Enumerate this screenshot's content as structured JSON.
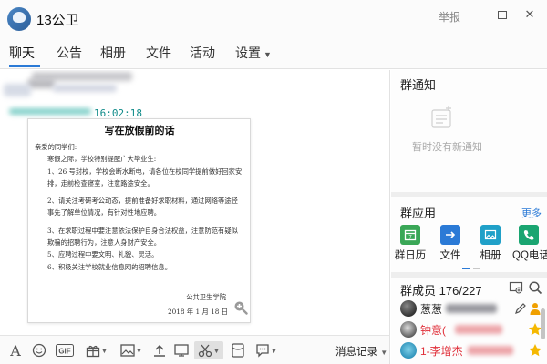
{
  "window": {
    "title": "13公卫",
    "report_label": "举报"
  },
  "tabs": [
    {
      "label": "聊天",
      "active": true
    },
    {
      "label": "公告"
    },
    {
      "label": "相册"
    },
    {
      "label": "文件"
    },
    {
      "label": "活动"
    },
    {
      "label": "设置"
    }
  ],
  "chat": {
    "message_time": "16:02:18",
    "document": {
      "title": "写在放假前的话",
      "greeting": "亲爱的同学们:",
      "intro": "寒假之际，学校特别提醒广大毕业生:",
      "items": [
        "1、26 号封校，学校会断水断电，请各位在校同学提前做好回家安排，走前检查寝室，注意路途安全。",
        "2、请关注考研考公动态，提前准备好求职材料，通过网络等途径事先了解单位情况，有针对性地应聘。",
        "3、在求职过程中要注意依法保护自身合法权益，注意防范有疑似欺骗的招聘行为，注意人身财产安全。",
        "5、应聘过程中要文明、礼貌、灵活。",
        "6、积极关注学校就业信息网的招聘信息。"
      ],
      "signature": "公共卫生学院",
      "date": "2018 年 1 月 18 日"
    }
  },
  "toolbar": {
    "history_label": "消息记录"
  },
  "notice": {
    "header": "群通知",
    "empty_text": "暂时没有新通知"
  },
  "apps": {
    "header": "群应用",
    "more_label": "更多",
    "items": [
      {
        "label": "群日历",
        "color": "#3aa757"
      },
      {
        "label": "文件",
        "color": "#2b7ad6"
      },
      {
        "label": "相册",
        "color": "#20a0c8"
      },
      {
        "label": "QQ电话",
        "color": "#1aa571"
      }
    ]
  },
  "members": {
    "header": "群成员",
    "count": "176/227",
    "list": [
      {
        "name": "葱葱"
      },
      {
        "name": "钟意("
      },
      {
        "name": "1-李增杰"
      }
    ]
  },
  "colors": {
    "accent": "#2b7ad6",
    "timestamp": "#128c8a",
    "member_name_red": "#e0303a"
  }
}
